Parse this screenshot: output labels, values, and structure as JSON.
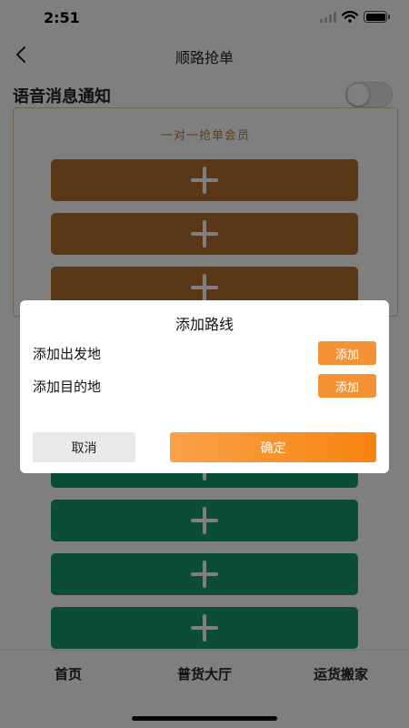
{
  "status_bar": {
    "time": "2:51"
  },
  "nav": {
    "title": "顺路抢单",
    "back_icon": "chevron-left-icon"
  },
  "voice_notification": {
    "label": "语音消息通知",
    "enabled": false
  },
  "member_section": {
    "title": "一对一抢单会员"
  },
  "slots": {
    "brown": [
      {
        "icon": "plus-icon"
      },
      {
        "icon": "plus-icon"
      },
      {
        "icon": "plus-icon"
      }
    ],
    "green": [
      {
        "icon": "plus-icon"
      },
      {
        "icon": "plus-icon"
      },
      {
        "icon": "plus-icon"
      },
      {
        "icon": "plus-icon"
      }
    ]
  },
  "tab_bar": {
    "tabs": [
      {
        "label": "首页"
      },
      {
        "label": "普货大厅"
      },
      {
        "label": "运货搬家"
      }
    ]
  },
  "dialog": {
    "title": "添加路线",
    "departure_label": "添加出发地",
    "destination_label": "添加目的地",
    "add_label": "添加",
    "cancel_label": "取消",
    "confirm_label": "确定"
  },
  "colors": {
    "accent_orange": "#f59236",
    "brown_slot": "#b46e2e",
    "green_slot": "#189a6c",
    "member_title": "#c07a2a"
  }
}
